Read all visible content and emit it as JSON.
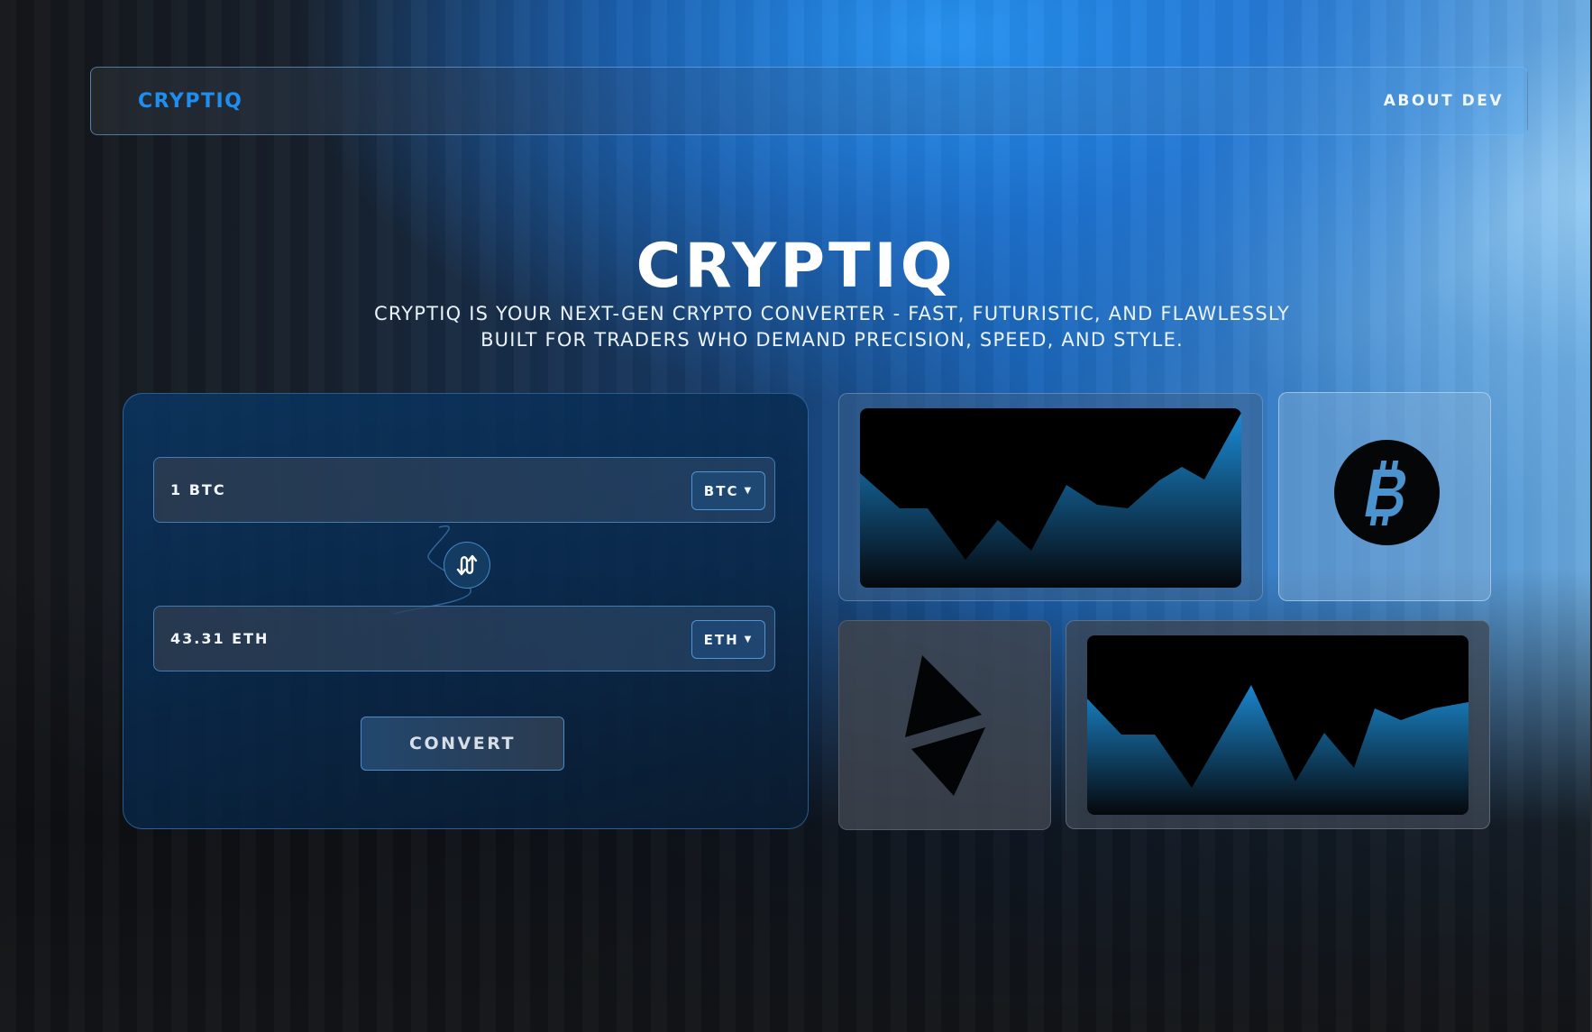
{
  "navbar": {
    "logo": "CRYPTIQ",
    "about_link": "ABOUT DEV"
  },
  "hero": {
    "title": "CRYPTIQ",
    "subtitle": "CRYPTIQ IS YOUR NEXT-GEN CRYPTO CONVERTER - FAST, FUTURISTIC, AND FLAWLESSLY BUILT FOR TRADERS WHO DEMAND PRECISION, SPEED, AND STYLE."
  },
  "converter": {
    "from_value": "1 BTC",
    "from_currency": "BTC",
    "to_value": "43.31 ETH",
    "to_currency": "ETH",
    "convert_label": "CONVERT"
  },
  "cards": {
    "chart_top": {
      "icon": "area-chart-icon"
    },
    "bitcoin": {
      "icon": "bitcoin-icon",
      "symbol": "₿"
    },
    "ethereum": {
      "icon": "ethereum-icon"
    },
    "chart_bottom": {
      "icon": "area-chart-icon"
    }
  },
  "colors": {
    "accent": "#1e8ef0",
    "chart_fill_top": "#1a86cc",
    "chart_fill_bottom": "#05080c",
    "chart_background": "#000000"
  }
}
